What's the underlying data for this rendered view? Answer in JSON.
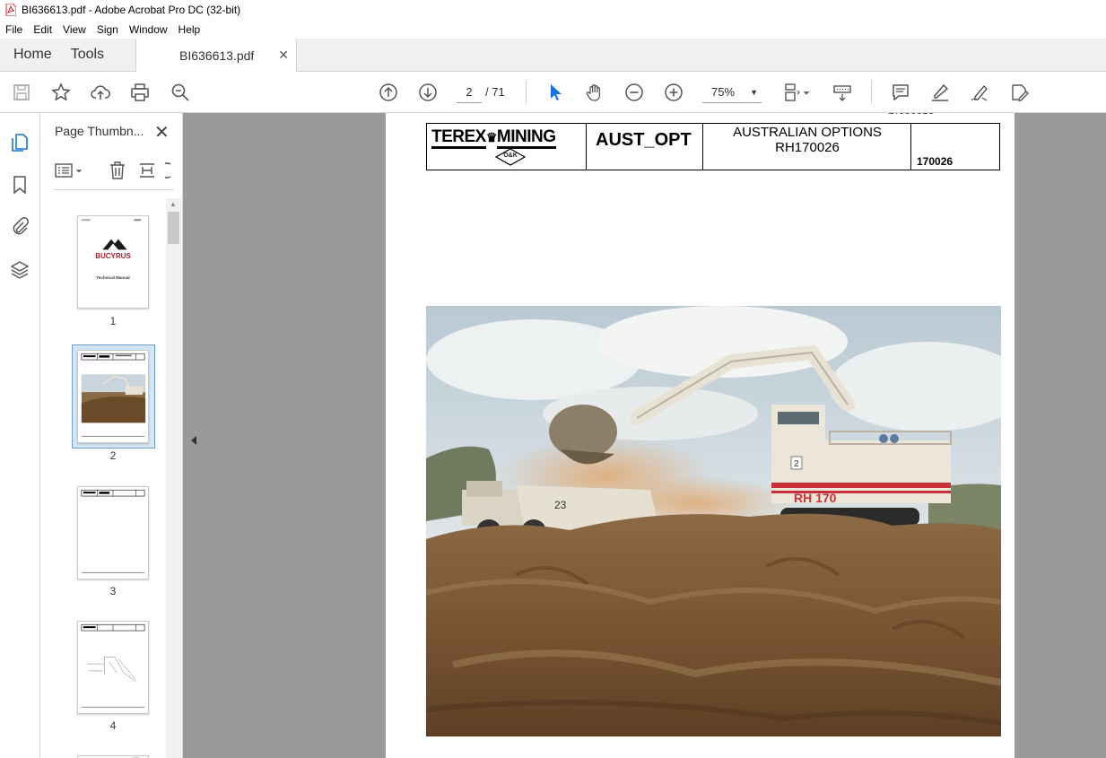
{
  "window": {
    "title": "BI636613.pdf - Adobe Acrobat Pro DC (32-bit)"
  },
  "menu": {
    "items": [
      "File",
      "Edit",
      "View",
      "Sign",
      "Window",
      "Help"
    ]
  },
  "tabs": {
    "home": "Home",
    "tools": "Tools",
    "document": "BI636613.pdf"
  },
  "toolbar": {
    "current_page": "2",
    "total_pages": "/ 71",
    "zoom": "75%"
  },
  "panel": {
    "title": "Page Thumbn...",
    "thumbnails": [
      "1",
      "2",
      "3",
      "4"
    ],
    "selected": "2"
  },
  "thumb1": {
    "brand": "BUCYRUS",
    "caption": "Technical Manual"
  },
  "document": {
    "brand_left": "TEREX",
    "brand_right": "MINING",
    "dk_mark": "O&K",
    "code": "AUST_OPT",
    "title_line1": "AUSTRALIAN OPTIONS",
    "title_line2": "RH170026",
    "number": "170026",
    "photo": {
      "machine_label": "RH 170",
      "truck_number": "23",
      "cab_number": "2"
    }
  },
  "colors": {
    "accent_blue": "#1473e6",
    "acrobat_red": "#d7282f"
  }
}
